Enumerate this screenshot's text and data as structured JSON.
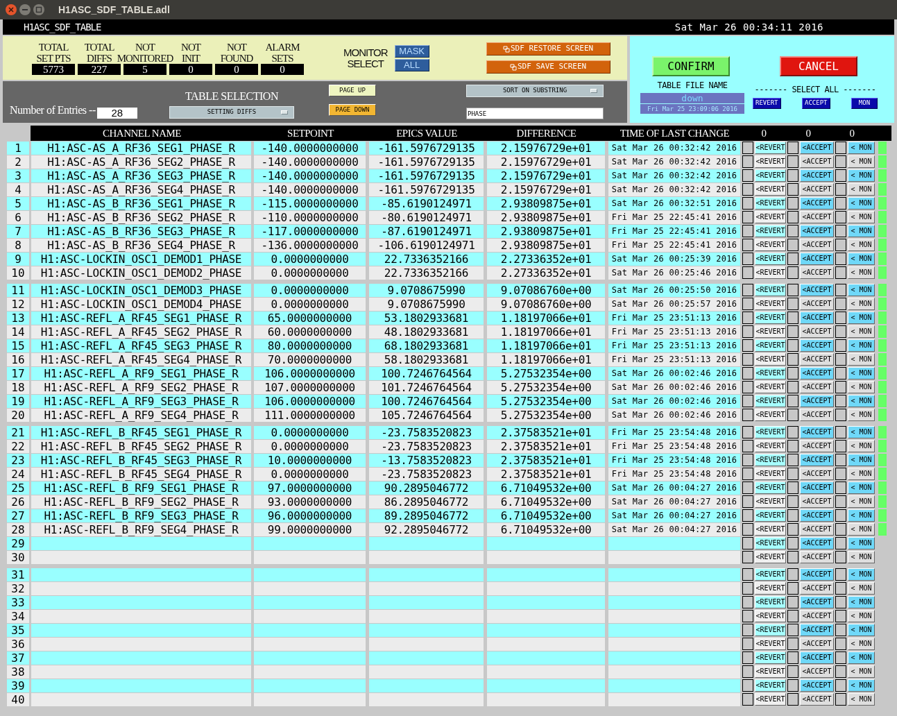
{
  "window": {
    "title": "H1ASC_SDF_TABLE.adl"
  },
  "screen": {
    "title": "H1ASC_SDF_TABLE",
    "clock": "Sat Mar 26 00:34:11 2016"
  },
  "stats": [
    {
      "label": "TOTAL\nSET PTS",
      "value": "5773"
    },
    {
      "label": "TOTAL\nDIFFS",
      "value": "227"
    },
    {
      "label": "NOT\nMONITORED",
      "value": "5"
    },
    {
      "label": "NOT\nINIT",
      "value": "0"
    },
    {
      "label": "NOT\nFOUND",
      "value": "0"
    },
    {
      "label": "ALARM\nSETS",
      "value": "0"
    }
  ],
  "monitor_select": {
    "label": "MONITOR\nSELECT",
    "options": [
      "MASK",
      "ALL"
    ]
  },
  "screen_buttons": [
    "SDF RESTORE SCREEN",
    "SDF SAVE SCREEN"
  ],
  "entries": {
    "label": "Number of Entries --",
    "value": "28"
  },
  "table_selection": {
    "label": "TABLE SELECTION",
    "value": "SETTING DIFFS"
  },
  "paging": [
    "PAGE UP",
    "PAGE DOWN"
  ],
  "sort": {
    "label": "SORT ON SUBSTRING",
    "value": "PHASE"
  },
  "actions": {
    "confirm": "CONFIRM",
    "cancel": "CANCEL"
  },
  "table_file": {
    "label": "TABLE FILE NAME",
    "name": "down",
    "time": "Fri Mar 25 23:09:06 2016"
  },
  "select_all": {
    "label": "------- SELECT ALL -------",
    "buttons": [
      "REVERT",
      "ACCEPT",
      "MON"
    ]
  },
  "columns": [
    "CHANNEL NAME",
    "SETPOINT",
    "EPICS VALUE",
    "DIFFERENCE",
    "TIME OF LAST CHANGE",
    "0",
    "0",
    "0"
  ],
  "rows": [
    {
      "n": "1",
      "channel": "H1:ASC-AS_A_RF36_SEG1_PHASE_R",
      "setpoint": "-140.0000000000",
      "epics_value": "-161.5976729135",
      "difference": "2.15976729e+01",
      "time": "Sat Mar 26 00:32:42 2016",
      "checks": [
        false,
        false,
        false
      ],
      "buttons": [
        "<REVERT",
        "<ACCEPT",
        "< MON"
      ],
      "indicator": true
    },
    {
      "n": "2",
      "channel": "H1:ASC-AS_A_RF36_SEG2_PHASE_R",
      "setpoint": "-140.0000000000",
      "epics_value": "-161.5976729135",
      "difference": "2.15976729e+01",
      "time": "Sat Mar 26 00:32:42 2016",
      "checks": [
        false,
        false,
        false
      ],
      "buttons": [
        "<REVERT",
        "<ACCEPT",
        "< MON"
      ],
      "indicator": true
    },
    {
      "n": "3",
      "channel": "H1:ASC-AS_A_RF36_SEG3_PHASE_R",
      "setpoint": "-140.0000000000",
      "epics_value": "-161.5976729135",
      "difference": "2.15976729e+01",
      "time": "Sat Mar 26 00:32:42 2016",
      "checks": [
        false,
        false,
        false
      ],
      "buttons": [
        "<REVERT",
        "<ACCEPT",
        "< MON"
      ],
      "indicator": true
    },
    {
      "n": "4",
      "channel": "H1:ASC-AS_A_RF36_SEG4_PHASE_R",
      "setpoint": "-140.0000000000",
      "epics_value": "-161.5976729135",
      "difference": "2.15976729e+01",
      "time": "Sat Mar 26 00:32:42 2016",
      "checks": [
        false,
        false,
        false
      ],
      "buttons": [
        "<REVERT",
        "<ACCEPT",
        "< MON"
      ],
      "indicator": true
    },
    {
      "n": "5",
      "channel": "H1:ASC-AS_B_RF36_SEG1_PHASE_R",
      "setpoint": "-115.0000000000",
      "epics_value": "-85.6190124971",
      "difference": "2.93809875e+01",
      "time": "Sat Mar 26 00:32:51 2016",
      "checks": [
        false,
        false,
        false
      ],
      "buttons": [
        "<REVERT",
        "<ACCEPT",
        "< MON"
      ],
      "indicator": true
    },
    {
      "n": "6",
      "channel": "H1:ASC-AS_B_RF36_SEG2_PHASE_R",
      "setpoint": "-110.0000000000",
      "epics_value": "-80.6190124971",
      "difference": "2.93809875e+01",
      "time": "Fri Mar 25 22:45:41 2016",
      "checks": [
        false,
        false,
        false
      ],
      "buttons": [
        "<REVERT",
        "<ACCEPT",
        "< MON"
      ],
      "indicator": true
    },
    {
      "n": "7",
      "channel": "H1:ASC-AS_B_RF36_SEG3_PHASE_R",
      "setpoint": "-117.0000000000",
      "epics_value": "-87.6190124971",
      "difference": "2.93809875e+01",
      "time": "Fri Mar 25 22:45:41 2016",
      "checks": [
        false,
        false,
        false
      ],
      "buttons": [
        "<REVERT",
        "<ACCEPT",
        "< MON"
      ],
      "indicator": true
    },
    {
      "n": "8",
      "channel": "H1:ASC-AS_B_RF36_SEG4_PHASE_R",
      "setpoint": "-136.0000000000",
      "epics_value": "-106.6190124971",
      "difference": "2.93809875e+01",
      "time": "Fri Mar 25 22:45:41 2016",
      "checks": [
        false,
        false,
        false
      ],
      "buttons": [
        "<REVERT",
        "<ACCEPT",
        "< MON"
      ],
      "indicator": true
    },
    {
      "n": "9",
      "channel": "H1:ASC-LOCKIN_OSC1_DEMOD1_PHASE",
      "setpoint": "0.0000000000",
      "epics_value": "22.7336352166",
      "difference": "2.27336352e+01",
      "time": "Sat Mar 26 00:25:39 2016",
      "checks": [
        false,
        false,
        false
      ],
      "buttons": [
        "<REVERT",
        "<ACCEPT",
        "< MON"
      ],
      "indicator": true
    },
    {
      "n": "10",
      "channel": "H1:ASC-LOCKIN_OSC1_DEMOD2_PHASE",
      "setpoint": "0.0000000000",
      "epics_value": "22.7336352166",
      "difference": "2.27336352e+01",
      "time": "Sat Mar 26 00:25:46 2016",
      "checks": [
        false,
        false,
        false
      ],
      "buttons": [
        "<REVERT",
        "<ACCEPT",
        "< MON"
      ],
      "indicator": true
    },
    {
      "n": "11",
      "channel": "H1:ASC-LOCKIN_OSC1_DEMOD3_PHASE",
      "setpoint": "0.0000000000",
      "epics_value": "9.0708675990",
      "difference": "9.07086760e+00",
      "time": "Sat Mar 26 00:25:50 2016",
      "checks": [
        false,
        false,
        false
      ],
      "buttons": [
        "<REVERT",
        "<ACCEPT",
        "< MON"
      ],
      "indicator": true
    },
    {
      "n": "12",
      "channel": "H1:ASC-LOCKIN_OSC1_DEMOD4_PHASE",
      "setpoint": "0.0000000000",
      "epics_value": "9.0708675990",
      "difference": "9.07086760e+00",
      "time": "Sat Mar 26 00:25:57 2016",
      "checks": [
        false,
        false,
        false
      ],
      "buttons": [
        "<REVERT",
        "<ACCEPT",
        "< MON"
      ],
      "indicator": true
    },
    {
      "n": "13",
      "channel": "H1:ASC-REFL_A_RF45_SEG1_PHASE_R",
      "setpoint": "65.0000000000",
      "epics_value": "53.1802933681",
      "difference": "1.18197066e+01",
      "time": "Fri Mar 25 23:51:13 2016",
      "checks": [
        false,
        false,
        false
      ],
      "buttons": [
        "<REVERT",
        "<ACCEPT",
        "< MON"
      ],
      "indicator": true
    },
    {
      "n": "14",
      "channel": "H1:ASC-REFL_A_RF45_SEG2_PHASE_R",
      "setpoint": "60.0000000000",
      "epics_value": "48.1802933681",
      "difference": "1.18197066e+01",
      "time": "Fri Mar 25 23:51:13 2016",
      "checks": [
        false,
        false,
        false
      ],
      "buttons": [
        "<REVERT",
        "<ACCEPT",
        "< MON"
      ],
      "indicator": true
    },
    {
      "n": "15",
      "channel": "H1:ASC-REFL_A_RF45_SEG3_PHASE_R",
      "setpoint": "80.0000000000",
      "epics_value": "68.1802933681",
      "difference": "1.18197066e+01",
      "time": "Fri Mar 25 23:51:13 2016",
      "checks": [
        false,
        false,
        false
      ],
      "buttons": [
        "<REVERT",
        "<ACCEPT",
        "< MON"
      ],
      "indicator": true
    },
    {
      "n": "16",
      "channel": "H1:ASC-REFL_A_RF45_SEG4_PHASE_R",
      "setpoint": "70.0000000000",
      "epics_value": "58.1802933681",
      "difference": "1.18197066e+01",
      "time": "Fri Mar 25 23:51:13 2016",
      "checks": [
        false,
        false,
        false
      ],
      "buttons": [
        "<REVERT",
        "<ACCEPT",
        "< MON"
      ],
      "indicator": true
    },
    {
      "n": "17",
      "channel": "H1:ASC-REFL_A_RF9_SEG1_PHASE_R",
      "setpoint": "106.0000000000",
      "epics_value": "100.7246764564",
      "difference": "5.27532354e+00",
      "time": "Sat Mar 26 00:02:46 2016",
      "checks": [
        false,
        false,
        false
      ],
      "buttons": [
        "<REVERT",
        "<ACCEPT",
        "< MON"
      ],
      "indicator": true
    },
    {
      "n": "18",
      "channel": "H1:ASC-REFL_A_RF9_SEG2_PHASE_R",
      "setpoint": "107.0000000000",
      "epics_value": "101.7246764564",
      "difference": "5.27532354e+00",
      "time": "Sat Mar 26 00:02:46 2016",
      "checks": [
        false,
        false,
        false
      ],
      "buttons": [
        "<REVERT",
        "<ACCEPT",
        "< MON"
      ],
      "indicator": true
    },
    {
      "n": "19",
      "channel": "H1:ASC-REFL_A_RF9_SEG3_PHASE_R",
      "setpoint": "106.0000000000",
      "epics_value": "100.7246764564",
      "difference": "5.27532354e+00",
      "time": "Sat Mar 26 00:02:46 2016",
      "checks": [
        false,
        false,
        false
      ],
      "buttons": [
        "<REVERT",
        "<ACCEPT",
        "< MON"
      ],
      "indicator": true
    },
    {
      "n": "20",
      "channel": "H1:ASC-REFL_A_RF9_SEG4_PHASE_R",
      "setpoint": "111.0000000000",
      "epics_value": "105.7246764564",
      "difference": "5.27532354e+00",
      "time": "Sat Mar 26 00:02:46 2016",
      "checks": [
        false,
        false,
        false
      ],
      "buttons": [
        "<REVERT",
        "<ACCEPT",
        "< MON"
      ],
      "indicator": true
    },
    {
      "n": "21",
      "channel": "H1:ASC-REFL_B_RF45_SEG1_PHASE_R",
      "setpoint": "0.0000000000",
      "epics_value": "-23.7583520823",
      "difference": "2.37583521e+01",
      "time": "Fri Mar 25 23:54:48 2016",
      "checks": [
        false,
        false,
        false
      ],
      "buttons": [
        "<REVERT",
        "<ACCEPT",
        "< MON"
      ],
      "indicator": true
    },
    {
      "n": "22",
      "channel": "H1:ASC-REFL_B_RF45_SEG2_PHASE_R",
      "setpoint": "0.0000000000",
      "epics_value": "-23.7583520823",
      "difference": "2.37583521e+01",
      "time": "Fri Mar 25 23:54:48 2016",
      "checks": [
        false,
        false,
        false
      ],
      "buttons": [
        "<REVERT",
        "<ACCEPT",
        "< MON"
      ],
      "indicator": true
    },
    {
      "n": "23",
      "channel": "H1:ASC-REFL_B_RF45_SEG3_PHASE_R",
      "setpoint": "10.0000000000",
      "epics_value": "-13.7583520823",
      "difference": "2.37583521e+01",
      "time": "Fri Mar 25 23:54:48 2016",
      "checks": [
        false,
        false,
        false
      ],
      "buttons": [
        "<REVERT",
        "<ACCEPT",
        "< MON"
      ],
      "indicator": true
    },
    {
      "n": "24",
      "channel": "H1:ASC-REFL_B_RF45_SEG4_PHASE_R",
      "setpoint": "0.0000000000",
      "epics_value": "-23.7583520823",
      "difference": "2.37583521e+01",
      "time": "Fri Mar 25 23:54:48 2016",
      "checks": [
        false,
        false,
        false
      ],
      "buttons": [
        "<REVERT",
        "<ACCEPT",
        "< MON"
      ],
      "indicator": true
    },
    {
      "n": "25",
      "channel": "H1:ASC-REFL_B_RF9_SEG1_PHASE_R",
      "setpoint": "97.0000000000",
      "epics_value": "90.2895046772",
      "difference": "6.71049532e+00",
      "time": "Sat Mar 26 00:04:27 2016",
      "checks": [
        false,
        false,
        false
      ],
      "buttons": [
        "<REVERT",
        "<ACCEPT",
        "< MON"
      ],
      "indicator": true
    },
    {
      "n": "26",
      "channel": "H1:ASC-REFL_B_RF9_SEG2_PHASE_R",
      "setpoint": "93.0000000000",
      "epics_value": "86.2895046772",
      "difference": "6.71049532e+00",
      "time": "Sat Mar 26 00:04:27 2016",
      "checks": [
        false,
        false,
        false
      ],
      "buttons": [
        "<REVERT",
        "<ACCEPT",
        "< MON"
      ],
      "indicator": true
    },
    {
      "n": "27",
      "channel": "H1:ASC-REFL_B_RF9_SEG3_PHASE_R",
      "setpoint": "96.0000000000",
      "epics_value": "89.2895046772",
      "difference": "6.71049532e+00",
      "time": "Sat Mar 26 00:04:27 2016",
      "checks": [
        false,
        false,
        false
      ],
      "buttons": [
        "<REVERT",
        "<ACCEPT",
        "< MON"
      ],
      "indicator": true
    },
    {
      "n": "28",
      "channel": "H1:ASC-REFL_B_RF9_SEG4_PHASE_R",
      "setpoint": "99.0000000000",
      "epics_value": "92.2895046772",
      "difference": "6.71049532e+00",
      "time": "Sat Mar 26 00:04:27 2016",
      "checks": [
        false,
        false,
        false
      ],
      "buttons": [
        "<REVERT",
        "<ACCEPT",
        "< MON"
      ],
      "indicator": true
    },
    {
      "n": "29",
      "checks": [
        false,
        false,
        false
      ],
      "buttons": [
        "<REVERT",
        "<ACCEPT",
        "< MON"
      ],
      "indicator": false
    },
    {
      "n": "30",
      "checks": [
        false,
        false,
        false
      ],
      "buttons": [
        "<REVERT",
        "<ACCEPT",
        "< MON"
      ],
      "indicator": false
    },
    {
      "n": "31",
      "checks": [
        false,
        false,
        false
      ],
      "buttons": [
        "<REVERT",
        "<ACCEPT",
        "< MON"
      ],
      "indicator": false
    },
    {
      "n": "32",
      "checks": [
        false,
        false,
        false
      ],
      "buttons": [
        "<REVERT",
        "<ACCEPT",
        "< MON"
      ],
      "indicator": false
    },
    {
      "n": "33",
      "checks": [
        false,
        false,
        false
      ],
      "buttons": [
        "<REVERT",
        "<ACCEPT",
        "< MON"
      ],
      "indicator": false
    },
    {
      "n": "34",
      "checks": [
        false,
        false,
        false
      ],
      "buttons": [
        "<REVERT",
        "<ACCEPT",
        "< MON"
      ],
      "indicator": false
    },
    {
      "n": "35",
      "checks": [
        false,
        false,
        false
      ],
      "buttons": [
        "<REVERT",
        "<ACCEPT",
        "< MON"
      ],
      "indicator": false
    },
    {
      "n": "36",
      "checks": [
        false,
        false,
        false
      ],
      "buttons": [
        "<REVERT",
        "<ACCEPT",
        "< MON"
      ],
      "indicator": false
    },
    {
      "n": "37",
      "checks": [
        false,
        false,
        false
      ],
      "buttons": [
        "<REVERT",
        "<ACCEPT",
        "< MON"
      ],
      "indicator": false
    },
    {
      "n": "38",
      "checks": [
        false,
        false,
        false
      ],
      "buttons": [
        "<REVERT",
        "<ACCEPT",
        "< MON"
      ],
      "indicator": false
    },
    {
      "n": "39",
      "checks": [
        false,
        false,
        false
      ],
      "buttons": [
        "<REVERT",
        "<ACCEPT",
        "< MON"
      ],
      "indicator": false
    },
    {
      "n": "40",
      "checks": [
        false,
        false,
        false
      ],
      "buttons": [
        "<REVERT",
        "<ACCEPT",
        "< MON"
      ],
      "indicator": false
    }
  ]
}
